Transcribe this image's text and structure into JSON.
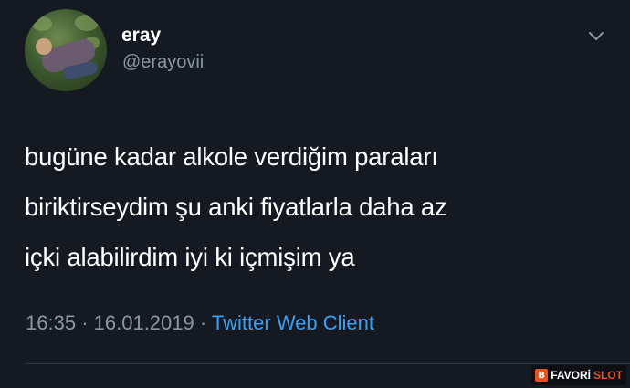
{
  "tweet": {
    "display_name": "eray",
    "handle": "@erayovii",
    "text_lines": [
      "bugüne kadar alkole verdiğim paraları",
      "biriktirseydim şu anki fiyatlarla daha az",
      "içki alabilirdim iyi ki içmişim ya"
    ],
    "time": "16:35",
    "separator": "·",
    "date": "16.01.2019",
    "source": "Twitter Web Client"
  },
  "watermark": {
    "part1": "FAVORİ",
    "part2": "SLOT"
  },
  "icons": {
    "menu": "chevron-down-icon",
    "avatar": "profile-photo"
  },
  "colors": {
    "background": "#151a22",
    "text": "#ffffff",
    "secondary": "#8a97a6",
    "link": "#3aa0f2",
    "watermark_accent": "#e8521c"
  }
}
